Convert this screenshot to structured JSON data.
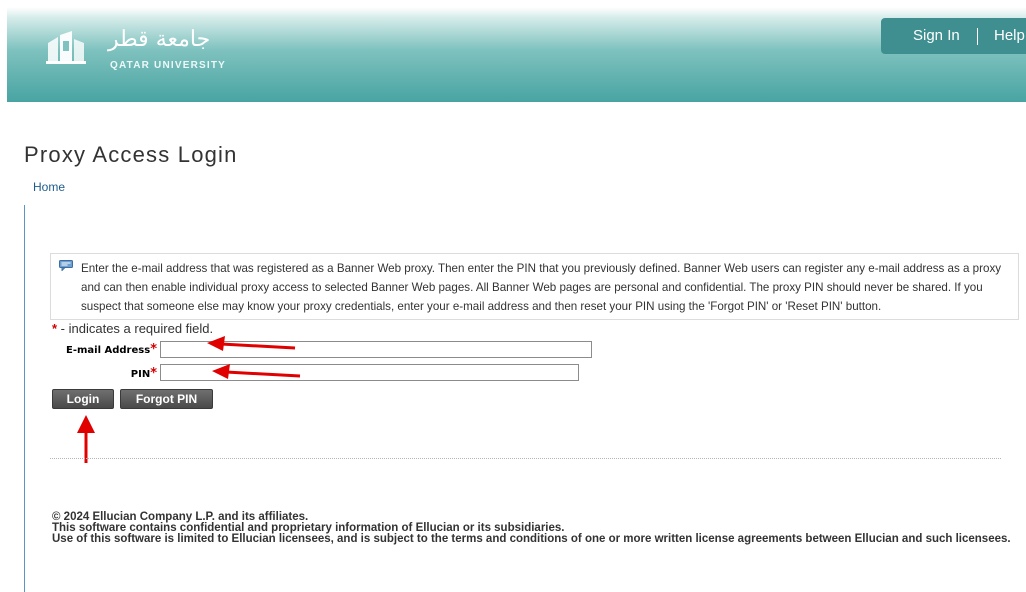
{
  "header": {
    "logo_arabic": "جامعة قطر",
    "logo_english": "QATAR UNIVERSITY",
    "nav": {
      "sign_in": "Sign In",
      "help": "Help"
    }
  },
  "page": {
    "title": "Proxy Access Login",
    "breadcrumb_home": "Home"
  },
  "info": {
    "text": "Enter the e-mail address that was registered as a Banner Web proxy. Then enter the PIN that you previously defined. Banner Web users can register any e-mail address as a proxy and can then enable individual proxy access to selected Banner Web pages. All Banner Web pages are personal and confidential. The proxy PIN should never be shared. If you suspect that someone else may know your proxy credentials, enter your e-mail address and then reset your PIN using the 'Forgot PIN' or 'Reset PIN' button."
  },
  "form": {
    "required_star": "*",
    "required_note": " - indicates a required field.",
    "email_label": "E-mail Address",
    "email_value": "",
    "pin_label": "PIN",
    "pin_value": "",
    "login_button": "Login",
    "forgot_button": "Forgot PIN"
  },
  "footer": {
    "copyright": "© 2024 Ellucian Company L.P. and its affiliates.",
    "line2": "This software contains confidential and proprietary information of Ellucian or its subsidiaries.",
    "line3": "Use of this software is limited to Ellucian licensees, and is subject to the terms and conditions of one or more written license agreements between Ellucian and such licensees."
  },
  "colors": {
    "header_teal": "#48a4a2",
    "nav_bg": "#3f8f91",
    "link_blue": "#1e5c8c",
    "required_red": "#d40000",
    "annotation_arrow": "#e00000",
    "button_gray": "#4a4a4a"
  },
  "icons": [
    "university-logo-icon",
    "info-comment-icon",
    "annotation-arrow-icon"
  ]
}
